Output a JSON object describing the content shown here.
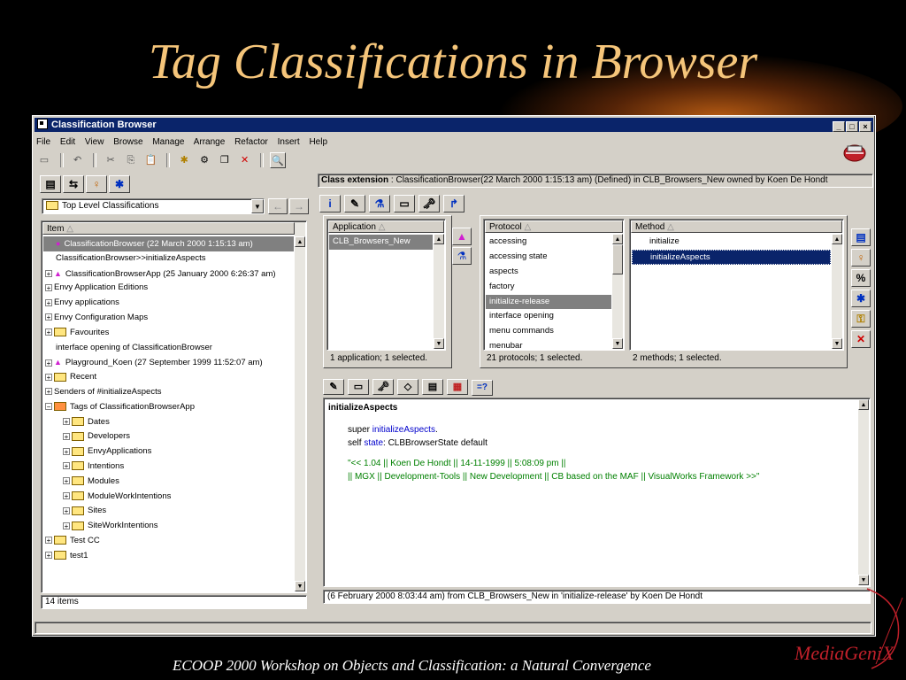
{
  "slide": {
    "title": "Tag Classifications in Browser",
    "footer": "ECOOP 2000 Workshop on Objects and Classification: a Natural Convergence",
    "logo": "MediaGeniX"
  },
  "window": {
    "title": "Classification Browser",
    "controls": [
      "_",
      "□",
      "×"
    ]
  },
  "menu": [
    "File",
    "Edit",
    "View",
    "Browse",
    "Manage",
    "Arrange",
    "Refactor",
    "Insert",
    "Help"
  ],
  "toolbar": {
    "icons": [
      "save-icon",
      "undo-icon",
      "cut-icon",
      "copy-icon",
      "paste-icon",
      "new-icon",
      "find-icon",
      "window-icon",
      "delete-icon",
      "inspect-icon"
    ],
    "glyphs": [
      "▭",
      "↶",
      "✂",
      "⎘",
      "📋",
      "✱",
      "⚙",
      "❐",
      "✕",
      "🔍"
    ]
  },
  "left": {
    "tab_glyphs": [
      "▤",
      "⇆",
      "♀",
      "✱"
    ],
    "dropdown": "Top Level Classifications",
    "back": "←",
    "forward": "→",
    "column": "Item",
    "rows": [
      {
        "text": "ClassificationBrowser (22 March 2000 1:15:13 am)",
        "exp": "",
        "icon": "dot",
        "indent": 1,
        "sel": true
      },
      {
        "text": "ClassificationBrowser>>initializeAspects",
        "exp": "",
        "icon": "",
        "indent": 1
      },
      {
        "text": "ClassificationBrowserApp (25 January 2000 6:26:37 am)",
        "exp": "+",
        "icon": "tri",
        "indent": 0
      },
      {
        "text": "Envy Application Editions",
        "exp": "+",
        "icon": "",
        "indent": 0
      },
      {
        "text": "Envy applications",
        "exp": "+",
        "icon": "",
        "indent": 0
      },
      {
        "text": "Envy Configuration Maps",
        "exp": "+",
        "icon": "",
        "indent": 0
      },
      {
        "text": "Favourites",
        "exp": "+",
        "icon": "folder",
        "indent": 0
      },
      {
        "text": "interface opening of ClassificationBrowser",
        "exp": "",
        "icon": "",
        "indent": 1
      },
      {
        "text": "Playground_Koen (27 September 1999 11:52:07 am)",
        "exp": "+",
        "icon": "tri",
        "indent": 0
      },
      {
        "text": "Recent",
        "exp": "+",
        "icon": "folder",
        "indent": 0
      },
      {
        "text": "Senders of #initializeAspects",
        "exp": "+",
        "icon": "",
        "indent": 0
      },
      {
        "text": "Tags of ClassificationBrowserApp",
        "exp": "−",
        "icon": "folder-open",
        "indent": 0
      },
      {
        "text": "Dates",
        "exp": "+",
        "icon": "folder",
        "indent": 2
      },
      {
        "text": "Developers",
        "exp": "+",
        "icon": "folder",
        "indent": 2
      },
      {
        "text": "EnvyApplications",
        "exp": "+",
        "icon": "folder",
        "indent": 2
      },
      {
        "text": "Intentions",
        "exp": "+",
        "icon": "folder",
        "indent": 2
      },
      {
        "text": "Modules",
        "exp": "+",
        "icon": "folder",
        "indent": 2
      },
      {
        "text": "ModuleWorkIntentions",
        "exp": "+",
        "icon": "folder",
        "indent": 2
      },
      {
        "text": "Sites",
        "exp": "+",
        "icon": "folder",
        "indent": 2
      },
      {
        "text": "SiteWorkIntentions",
        "exp": "+",
        "icon": "folder",
        "indent": 2
      },
      {
        "text": "Test CC",
        "exp": "+",
        "icon": "folder",
        "indent": 0
      },
      {
        "text": "test1",
        "exp": "+",
        "icon": "folder",
        "indent": 0
      }
    ],
    "status": "14 items"
  },
  "right": {
    "class_ext_label": "Class extension",
    "class_ext_text": " : ClassificationBrowser(22 March 2000 1:15:13 am) (Defined) in CLB_Browsers_New owned by Koen De Hondt",
    "tab_glyphs": [
      "i",
      "✎",
      "⚗",
      "▭",
      "🗝",
      "↱"
    ],
    "application": {
      "header": "Application",
      "rows": [
        "CLB_Browsers_New"
      ],
      "status": "1 application; 1 selected."
    },
    "view_toggle_glyphs": [
      "▲",
      "⚗"
    ],
    "protocol": {
      "header": "Protocol",
      "rows": [
        "accessing",
        "accessing state",
        "aspects",
        "factory",
        "initialize-release",
        "interface opening",
        "menu commands",
        "menubar"
      ],
      "selected": 4,
      "status": "21 protocols; 1 selected."
    },
    "method": {
      "header": "Method",
      "rows": [
        "initialize",
        "initializeAspects"
      ],
      "selected": 1,
      "status": "2 methods; 1 selected."
    },
    "side_glyphs": [
      "▤",
      "♀",
      "%",
      "✱",
      "⚿",
      "✕"
    ],
    "code_tab_glyphs": [
      "✎",
      "▭",
      "🗝",
      "◇",
      "▤",
      "▦",
      "=?"
    ],
    "code": {
      "method_name": "initializeAspects",
      "line1_a": "super ",
      "line1_b": "initializeAspects",
      "line1_c": ".",
      "line2_a": "self ",
      "line2_b": "state",
      "line2_c": ": CLBBrowserState default",
      "comment1": "\"<< 1.04 || Koen De Hondt || 14-11-1999 || 5:08:09 pm ||",
      "comment2": " || MGX || Development-Tools || New Development || CB based on the MAF || VisualWorks Framework >>\""
    },
    "code_status": "(6 February 2000 8:03:44 am) from CLB_Browsers_New in 'initialize-release' by Koen De Hondt"
  }
}
